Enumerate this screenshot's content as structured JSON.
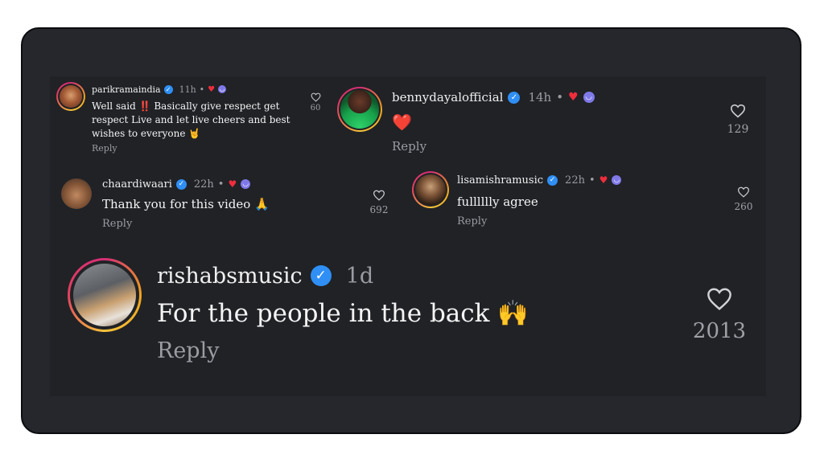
{
  "comments": [
    {
      "username": "parikramaindia",
      "time": "11h",
      "dot": "•",
      "text": "Well said ‼️ Basically give respect get respect Live and let live cheers and best wishes to everyone 🤘",
      "reply": "Reply",
      "likes": "60"
    },
    {
      "username": "bennydayalofficial",
      "time": "14h",
      "dot": "•",
      "text": "❤️",
      "reply": "Reply",
      "likes": "129"
    },
    {
      "username": "chaardiwaari",
      "time": "22h",
      "dot": "•",
      "text": "Thank you for this video 🙏",
      "reply": "Reply",
      "likes": "692"
    },
    {
      "username": "lisamishramusic",
      "time": "22h",
      "dot": "•",
      "text": "fulllllly agree",
      "reply": "Reply",
      "likes": "260"
    },
    {
      "username": "rishabsmusic",
      "time": "1d",
      "text": "For the people in the back 🙌",
      "reply": "Reply",
      "likes": "2013"
    }
  ],
  "icons": {
    "verified": "verified-badge-icon",
    "heart_reaction": "red-heart-icon",
    "smile_reaction": "smiling-face-icon",
    "like": "heart-outline-icon"
  },
  "colors": {
    "background": "#25272d",
    "panel": "#202226",
    "verified": "#2f8ff5",
    "heart_red": "#ef2d3c",
    "muted": "#9a9ca2"
  }
}
